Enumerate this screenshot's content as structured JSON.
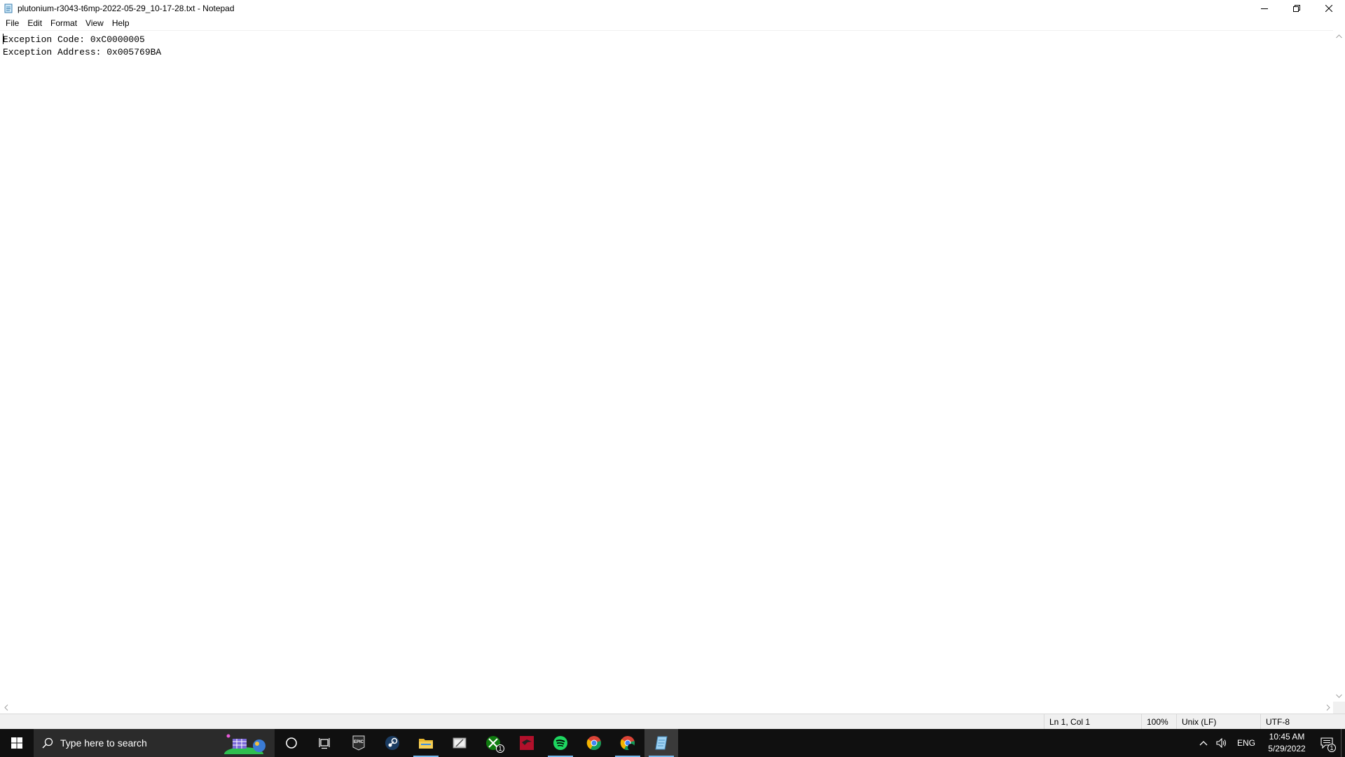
{
  "window": {
    "title": "plutonium-r3043-t6mp-2022-05-29_10-17-28.txt - Notepad",
    "app_icon": "notepad-icon"
  },
  "menu": {
    "items": [
      "File",
      "Edit",
      "Format",
      "View",
      "Help"
    ]
  },
  "editor": {
    "lines": [
      "Exception Code: 0xC0000005",
      "Exception Address: 0x005769BA"
    ]
  },
  "status": {
    "position": "Ln 1, Col 1",
    "zoom": "100%",
    "line_endings": "Unix (LF)",
    "encoding": "UTF-8"
  },
  "taskbar": {
    "search_placeholder": "Type here to search",
    "apps": [
      {
        "name": "cortana-icon"
      },
      {
        "name": "task-view-icon"
      },
      {
        "name": "epic-games-icon",
        "label": "EPIC"
      },
      {
        "name": "steam-icon"
      },
      {
        "name": "file-explorer-icon",
        "running": true
      },
      {
        "name": "snipping-tool-icon"
      },
      {
        "name": "xbox-icon",
        "badge": "1"
      },
      {
        "name": "red-app-icon"
      },
      {
        "name": "spotify-icon",
        "running": true
      },
      {
        "name": "chrome-icon"
      },
      {
        "name": "chrome-alt-icon",
        "running": true
      },
      {
        "name": "notepad-icon",
        "running": true,
        "active": true
      }
    ],
    "tray": {
      "language": "ENG",
      "time": "10:45 AM",
      "date": "5/29/2022",
      "notification_count": "1"
    }
  },
  "colors": {
    "taskbar_bg": "#101010",
    "search_bg": "#2b2b2b",
    "running_indicator": "#76b9ed",
    "statusbar_bg": "#f0f0f0"
  }
}
